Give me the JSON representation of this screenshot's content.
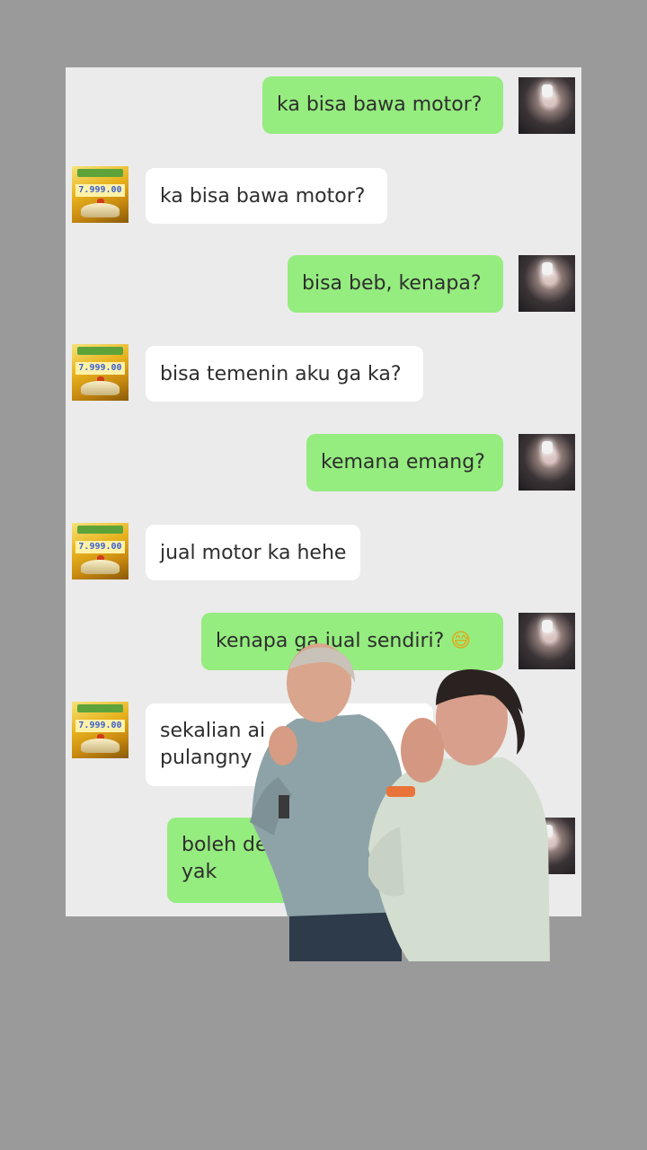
{
  "messages": [
    {
      "side": "out",
      "text": "ka bisa bawa motor?"
    },
    {
      "side": "in",
      "text": "ka bisa bawa motor?"
    },
    {
      "side": "out",
      "text": "bisa beb, kenapa?"
    },
    {
      "side": "in",
      "text": "bisa temenin aku ga ka?"
    },
    {
      "side": "out",
      "text": "kemana emang?"
    },
    {
      "side": "in",
      "text": "jual motor ka hehe"
    },
    {
      "side": "out",
      "text": "kenapa ga jual sendiri?",
      "emoji": "😅"
    },
    {
      "side": "in",
      "lines": [
        "sekalian ai",
        "pulangny"
      ]
    },
    {
      "side": "out",
      "lines": [
        "boleh dehh",
        "yak"
      ]
    }
  ],
  "contact_avatar_text": "7.999.00",
  "icons": {
    "my_avatar": "user-photo-avatar",
    "contact_avatar": "gold-prize-avatar"
  },
  "colors": {
    "outgoing_bubble": "#95ec7f",
    "incoming_bubble": "#ffffff",
    "chat_background": "#ebebeb",
    "page_background": "#9a9a9a"
  },
  "overlay": {
    "description_icon": "laughing-men-sticker"
  }
}
